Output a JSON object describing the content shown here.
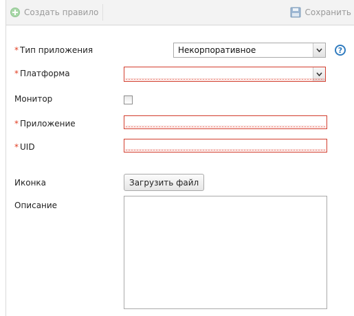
{
  "toolbar": {
    "create_label": "Создать правило",
    "save_label": "Сохранить"
  },
  "form": {
    "app_type": {
      "label": "Тип приложения",
      "required": "*",
      "value": "Некорпоративное",
      "help": "?"
    },
    "platform": {
      "label": "Платформа",
      "required": "*",
      "value": ""
    },
    "monitor": {
      "label": "Монитор",
      "checked": false
    },
    "application": {
      "label": "Приложение",
      "required": "*",
      "value": ""
    },
    "uid": {
      "label": "UID",
      "required": "*",
      "value": ""
    },
    "icon": {
      "label": "Иконка",
      "button_label": "Загрузить файл"
    },
    "description": {
      "label": "Описание",
      "value": ""
    }
  },
  "colors": {
    "required_marker": "#e03c20",
    "invalid_border": "#d23b2b",
    "help_icon": "#2f7bbf"
  }
}
